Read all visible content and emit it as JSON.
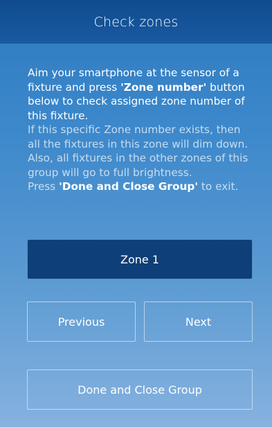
{
  "header": {
    "title": "Check zones"
  },
  "instructions": {
    "line1_a": "Aim your smartphone at the sensor of a fixture and press ",
    "line1_b": "'Zone number'",
    "line1_c": " button below to check assigned zone number of this fixture.",
    "line2": "If this specific Zone number exists, then all the fixtures in this zone will dim down. Also, all fixtures in the other zones of this group will go to full brightness.",
    "line3_a": "Press ",
    "line3_b": "'Done and Close Group'",
    "line3_c": " to exit."
  },
  "buttons": {
    "zone": "Zone 1",
    "previous": "Previous",
    "next": "Next",
    "done": "Done and Close Group"
  },
  "colors": {
    "header": "#14508f",
    "zone_button": "#0f3f78",
    "background_top": "#2f7ac0",
    "background_bottom": "#86b2df"
  }
}
